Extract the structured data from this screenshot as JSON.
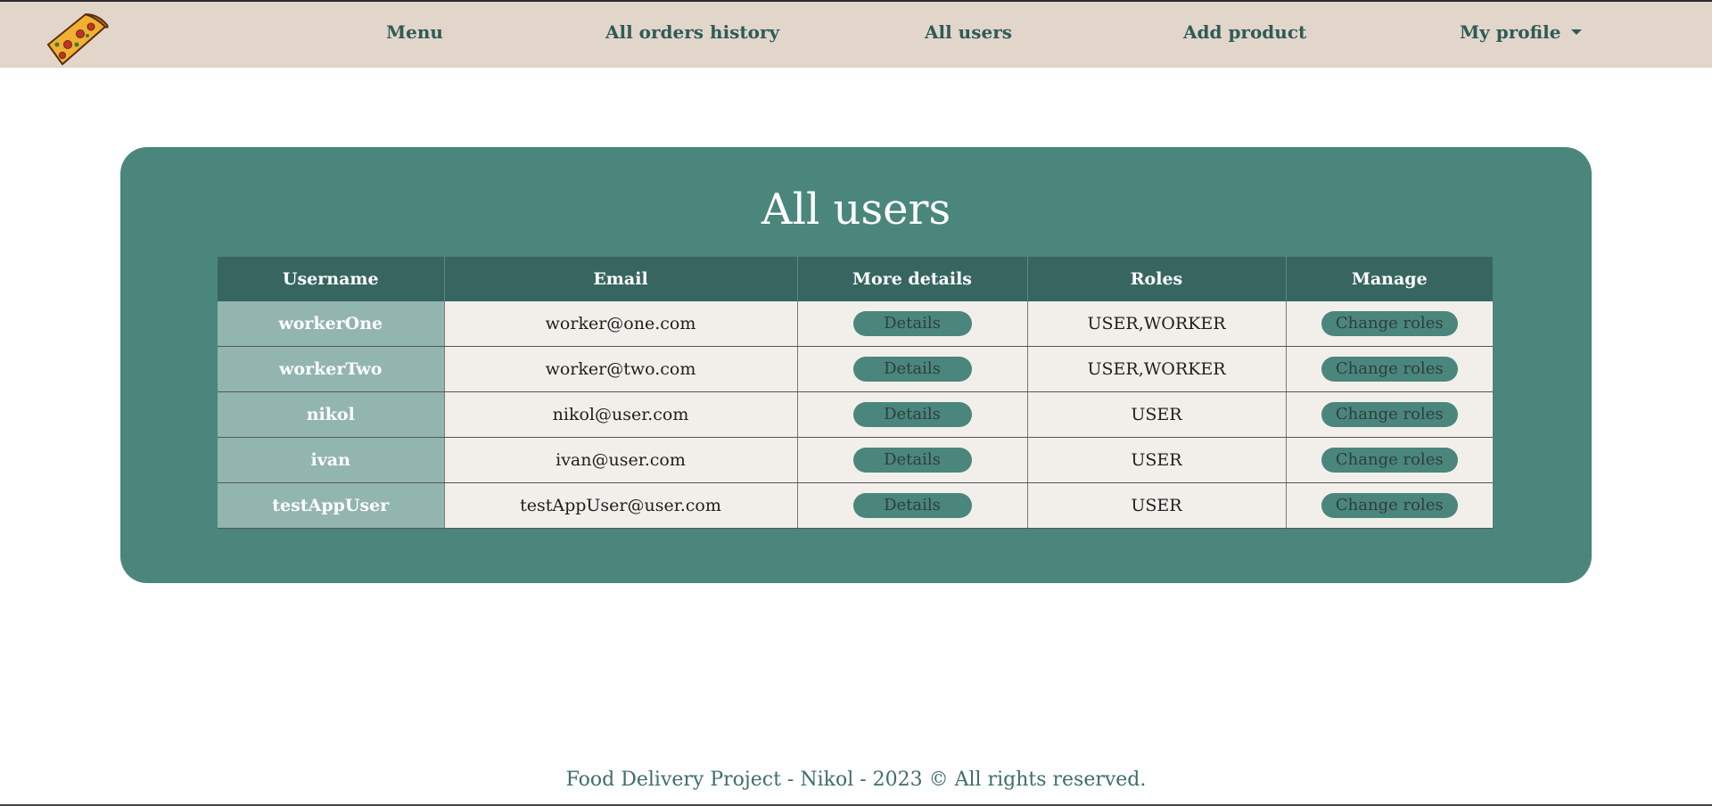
{
  "nav": {
    "logo_icon": "pizza-slice-icon",
    "menu": "Menu",
    "orders_history": "All orders history",
    "all_users": "All users",
    "add_product": "Add product",
    "my_profile": "My profile"
  },
  "main": {
    "title": "All users",
    "columns": [
      "Username",
      "Email",
      "More details",
      "Roles",
      "Manage"
    ],
    "rows": [
      {
        "username": "workerOne",
        "email": "worker@one.com",
        "details": "Details",
        "roles": "USER,WORKER",
        "manage": "Change roles"
      },
      {
        "username": "workerTwo",
        "email": "worker@two.com",
        "details": "Details",
        "roles": "USER,WORKER",
        "manage": "Change roles"
      },
      {
        "username": "nikol",
        "email": "nikol@user.com",
        "details": "Details",
        "roles": "USER",
        "manage": "Change roles"
      },
      {
        "username": "ivan",
        "email": "ivan@user.com",
        "details": "Details",
        "roles": "USER",
        "manage": "Change roles"
      },
      {
        "username": "testAppUser",
        "email": "testAppUser@user.com",
        "details": "Details",
        "roles": "USER",
        "manage": "Change roles"
      }
    ]
  },
  "footer": {
    "text": "Food Delivery Project - Nikol - 2023 © All rights reserved."
  },
  "colors": {
    "navbar_bg": "#e2d6cb",
    "accent": "#4a867c",
    "header_bg": "#376661",
    "username_cell_bg": "#93b5b0",
    "cell_bg": "#f2efea"
  }
}
